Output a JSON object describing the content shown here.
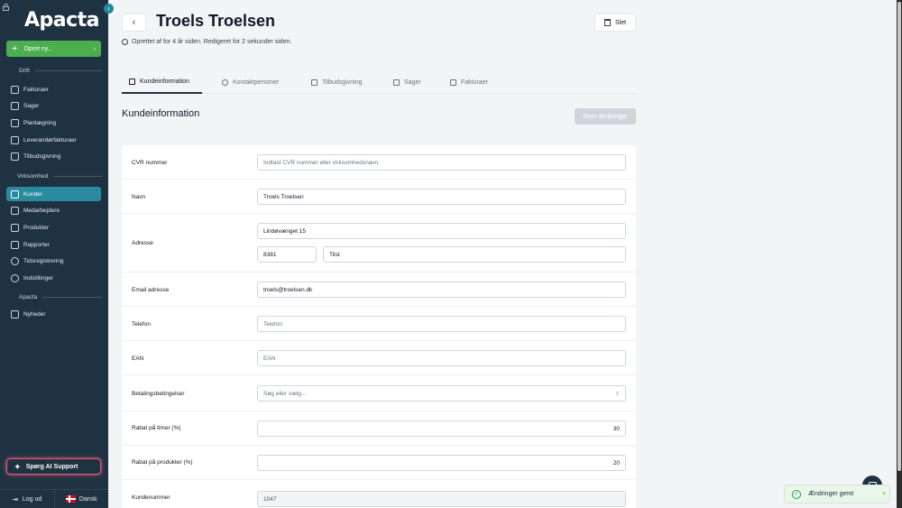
{
  "sidebar": {
    "logo": "Apacta",
    "new_button": "Opret ny...",
    "sections": [
      {
        "label": "Drift"
      },
      {
        "label": "Virksomhed"
      },
      {
        "label": "Apacta"
      }
    ],
    "items": [
      {
        "label": "Fakturaer",
        "icon": "invoice-icon"
      },
      {
        "label": "Sager",
        "icon": "folder-icon"
      },
      {
        "label": "Planlægning",
        "icon": "calendar-icon"
      },
      {
        "label": "Leverandørfakturaer",
        "icon": "supplier-invoice-icon"
      },
      {
        "label": "Tilbudsgivning",
        "icon": "quote-icon"
      },
      {
        "label": "Kunder",
        "icon": "users-icon",
        "active": true
      },
      {
        "label": "Medarbejdere",
        "icon": "employee-icon"
      },
      {
        "label": "Produkter",
        "icon": "box-icon"
      },
      {
        "label": "Rapporter",
        "icon": "chart-icon"
      },
      {
        "label": "Tidsregistrering",
        "icon": "clock-icon"
      },
      {
        "label": "Indstillinger",
        "icon": "gear-icon"
      },
      {
        "label": "Nyheder",
        "icon": "news-icon"
      }
    ],
    "ai_support": "Spørg AI Support",
    "logout": "Log ud",
    "language": "Dansk"
  },
  "header": {
    "title": "Troels Troelsen",
    "delete": "Slet",
    "meta": "Oprettet af for 4 år siden. Redigeret for 2 sekunder siden."
  },
  "tabs": [
    {
      "label": "Kundeinformation",
      "active": true
    },
    {
      "label": "Kontaktpersoner"
    },
    {
      "label": "Tilbudsgivning"
    },
    {
      "label": "Sager"
    },
    {
      "label": "Fakturaer"
    }
  ],
  "section": {
    "title": "Kundeinformation",
    "save": "Gem ændringer"
  },
  "form": {
    "cvr_label": "CVR nummer",
    "cvr_placeholder": "Indtast CVR nummer eller virksomhedsnavn",
    "name_label": "Navn",
    "name_value": "Troels Troelsen",
    "address_label": "Adresse",
    "address_value": "Lindøvænget 15",
    "zip_value": "8381",
    "city_value": "Tilst",
    "email_label": "Email adresse",
    "email_value": "troels@troelsen.dk",
    "phone_label": "Telefon",
    "phone_placeholder": "Telefon",
    "ean_label": "EAN",
    "ean_placeholder": "EAN",
    "payment_label": "Betalingsbetingelser",
    "payment_placeholder": "Søg eller vælg...",
    "discount_hours_label": "Rabat på timer (%)",
    "discount_hours_value": "30",
    "discount_products_label": "Rabat på produkter (%)",
    "discount_products_value": "20",
    "customer_no_label": "Kundenummer",
    "customer_no_value": "1047"
  },
  "toast": {
    "text": "Ændringer gemt"
  }
}
